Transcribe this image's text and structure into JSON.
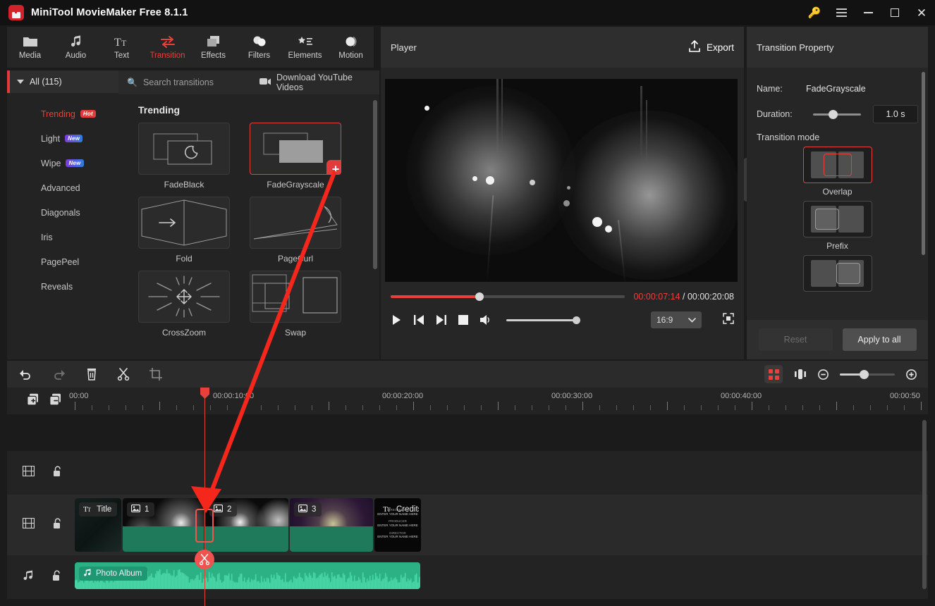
{
  "window": {
    "title": "MiniTool MovieMaker Free 8.1.1",
    "controls": {
      "key": "key-icon",
      "menu": "menu-icon",
      "minimize": "minimize",
      "maximize": "maximize",
      "close": "close"
    }
  },
  "toolbar": {
    "tabs": [
      {
        "label": "Media",
        "icon": "folder-icon",
        "active": false
      },
      {
        "label": "Audio",
        "icon": "music-note-icon",
        "active": false
      },
      {
        "label": "Text",
        "icon": "text-icon",
        "active": false
      },
      {
        "label": "Transition",
        "icon": "transition-arrows-icon",
        "active": true
      },
      {
        "label": "Effects",
        "icon": "layers-icon",
        "active": false
      },
      {
        "label": "Filters",
        "icon": "circles-icon",
        "active": false
      },
      {
        "label": "Elements",
        "icon": "star-list-icon",
        "active": false
      },
      {
        "label": "Motion",
        "icon": "motion-icon",
        "active": false
      }
    ]
  },
  "categories": {
    "all_label": "All (115)",
    "items": [
      {
        "label": "Trending",
        "badge": "Hot",
        "badge_type": "hot",
        "active": true
      },
      {
        "label": "Light",
        "badge": "New",
        "badge_type": "new",
        "active": false
      },
      {
        "label": "Wipe",
        "badge": "New",
        "badge_type": "new",
        "active": false
      },
      {
        "label": "Advanced",
        "badge": "",
        "badge_type": "",
        "active": false
      },
      {
        "label": "Diagonals",
        "badge": "",
        "badge_type": "",
        "active": false
      },
      {
        "label": "Iris",
        "badge": "",
        "badge_type": "",
        "active": false
      },
      {
        "label": "PagePeel",
        "badge": "",
        "badge_type": "",
        "active": false
      },
      {
        "label": "Reveals",
        "badge": "",
        "badge_type": "",
        "active": false
      }
    ]
  },
  "browse": {
    "search_placeholder": "Search transitions",
    "search_value": "",
    "download_label": "Download YouTube Videos",
    "section_title": "Trending",
    "transitions": [
      {
        "name": "FadeBlack",
        "selected": false
      },
      {
        "name": "FadeGrayscale",
        "selected": true
      },
      {
        "name": "Fold",
        "selected": false
      },
      {
        "name": "PageCurl",
        "selected": false
      },
      {
        "name": "CrossZoom",
        "selected": false
      },
      {
        "name": "Swap",
        "selected": false
      }
    ]
  },
  "player": {
    "title": "Player",
    "export_label": "Export",
    "current_time": "00:00:07:14",
    "separator": " / ",
    "total_time": "00:00:20:08",
    "progress_percent": 38,
    "aspect_ratio": "16:9",
    "controls": [
      "play-icon",
      "previous-frame-icon",
      "next-frame-icon",
      "stop-icon",
      "volume-icon"
    ]
  },
  "property": {
    "panel_title": "Transition Property",
    "name_label": "Name:",
    "name_value": "FadeGrayscale",
    "duration_label": "Duration:",
    "duration_value": "1.0 s",
    "mode_title": "Transition mode",
    "modes": [
      {
        "label": "Overlap",
        "selected": true
      },
      {
        "label": "Prefix",
        "selected": false
      },
      {
        "label": "",
        "selected": false
      }
    ],
    "reset_label": "Reset",
    "apply_label": "Apply to all"
  },
  "timeline": {
    "tools": [
      "undo-icon",
      "redo-icon",
      "delete-icon",
      "split-scissors-icon",
      "crop-icon"
    ],
    "right_tools": [
      "ai-sparkle-icon",
      "audio-detach-icon",
      "zoom-out-icon",
      "zoom-slider",
      "zoom-in-icon"
    ],
    "ruler_labels": [
      "00:00",
      "00:00:10:00",
      "00:00:20:00",
      "00:00:30:00",
      "00:00:40:00",
      "00:00:50"
    ],
    "track_head_buttons": [
      "add-track-icon",
      "remove-track-icon"
    ],
    "tracks": [
      {
        "type": "video",
        "icon": "film-icon",
        "lock": "unlock-icon",
        "clips": []
      },
      {
        "type": "video",
        "icon": "film-icon",
        "lock": "unlock-icon",
        "clips": [
          {
            "label": "Title",
            "icon": "text-icon",
            "kind": "title"
          },
          {
            "label": "1",
            "icon": "image-icon",
            "kind": "photo"
          },
          {
            "label": "2",
            "icon": "image-icon",
            "kind": "photo"
          },
          {
            "label": "3",
            "icon": "image-icon",
            "kind": "photo"
          },
          {
            "label": "Credits",
            "icon": "text-icon",
            "kind": "credits",
            "lines": [
              "DIRECTED BY",
              "ENTER YOUR NAME HERE",
              "PRODUCER",
              "ENTER YOUR NAME HERE",
              "DIRECTOR",
              "ENTER YOUR NAME HERE"
            ]
          }
        ]
      },
      {
        "type": "audio",
        "icon": "music-note-icon",
        "lock": "unlock-icon",
        "clips": [
          {
            "label": "Photo Album",
            "icon": "music-note-icon",
            "kind": "audio"
          }
        ]
      }
    ]
  },
  "colors": {
    "accent_red": "#e8413c",
    "audio_green": "#2bb183",
    "panel_bg": "#262626",
    "app_bg": "#1b1b1b"
  }
}
